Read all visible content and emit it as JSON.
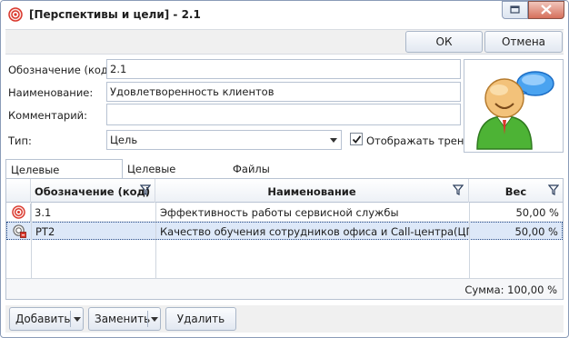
{
  "window": {
    "title": "[Перспективы и цели] - 2.1"
  },
  "toolbar": {
    "ok_label": "ОК",
    "cancel_label": "Отмена"
  },
  "form": {
    "code_label": "Обозначение (код):",
    "code_value": "2.1",
    "name_label": "Наименование:",
    "name_value": "Удовлетворенность клиентов",
    "comment_label": "Комментарий:",
    "comment_value": "",
    "type_label": "Тип:",
    "type_value": "Цель",
    "show_trend_label": "Отображать тренд:",
    "show_trend_checked": true
  },
  "tabs": [
    {
      "label": "Целевые показатели",
      "active": true
    },
    {
      "label": "Целевые значения",
      "active": false
    },
    {
      "label": "Файлы",
      "active": false
    }
  ],
  "grid": {
    "columns": [
      "Обозначение (код)",
      "Наименование",
      "Вес"
    ],
    "rows": [
      {
        "code": "3.1",
        "name": "Эффективность работы сервисной службы",
        "weight": "50,00 %",
        "icon": "target-icon",
        "selected": false
      },
      {
        "code": "РТ2",
        "name": "Качество обучения сотрудников офиса и Call-центра(ЦПП)",
        "weight": "50,00 %",
        "icon": "target-link-icon",
        "selected": true
      }
    ],
    "sum_text": "Сумма: 100,00 %"
  },
  "actions": {
    "add_label": "Добавить",
    "replace_label": "Заменить",
    "delete_label": "Удалить"
  },
  "colors": {
    "accent": "#dde8f8",
    "border": "#b7c2d2",
    "target_red": "#d9362b"
  }
}
